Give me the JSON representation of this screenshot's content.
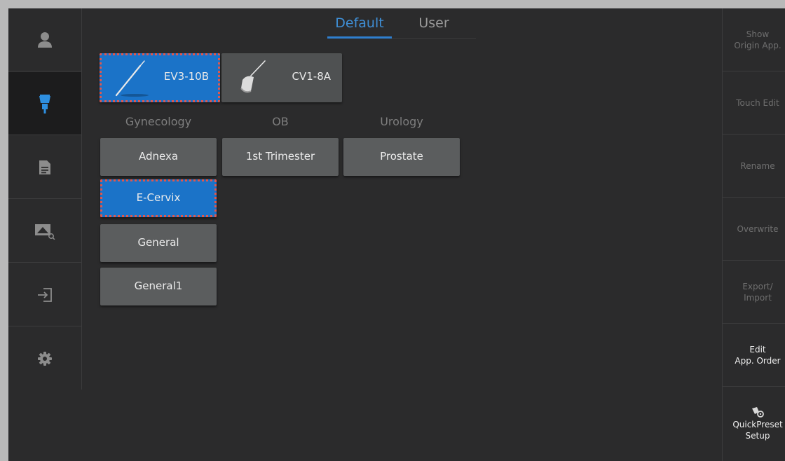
{
  "tabs": {
    "default": "Default",
    "user": "User",
    "active": "Default"
  },
  "probes": [
    {
      "label": "EV3-10B",
      "selected": true
    },
    {
      "label": "CV1-8A",
      "selected": false
    }
  ],
  "categories": [
    "Gynecology",
    "OB",
    "Urology"
  ],
  "apps": {
    "gynecology": [
      "Adnexa",
      "E-Cervix",
      "General",
      "General1"
    ],
    "ob": [
      "1st Trimester"
    ],
    "urology": [
      "Prostate"
    ],
    "selected": "E-Cervix"
  },
  "sidebar": {
    "items": [
      {
        "icon": "person-icon"
      },
      {
        "icon": "probe-icon",
        "active": true
      },
      {
        "icon": "document-icon"
      },
      {
        "icon": "image-review-icon"
      },
      {
        "icon": "exit-icon"
      },
      {
        "icon": "gear-icon"
      }
    ]
  },
  "right_panel": {
    "show_origin": [
      "Show",
      "Origin App."
    ],
    "touch_edit": "Touch Edit",
    "rename": "Rename",
    "overwrite": "Overwrite",
    "export_import": [
      "Export/",
      "Import"
    ],
    "edit_order": [
      "Edit",
      "App. Order"
    ],
    "quickpreset": [
      "QuickPreset",
      "Setup"
    ]
  },
  "colors": {
    "accent": "#1b73c8",
    "tab_active": "#3f8fd6",
    "selection_outline": "#e0584e",
    "background": "#2b2b2c"
  }
}
